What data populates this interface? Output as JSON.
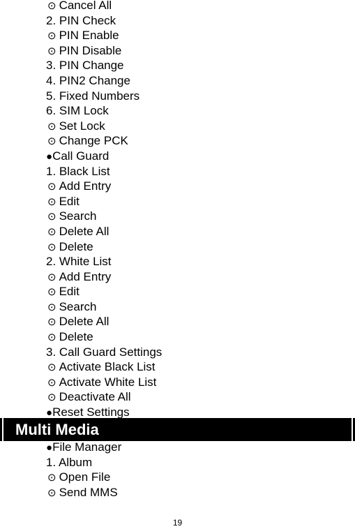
{
  "items_top": [
    {
      "type": "circle",
      "label": "Cancel All"
    },
    {
      "type": "numbered",
      "label": "2. PIN Check"
    },
    {
      "type": "circle",
      "label": "PIN Enable"
    },
    {
      "type": "circle",
      "label": "PIN Disable"
    },
    {
      "type": "numbered",
      "label": "3. PIN Change"
    },
    {
      "type": "numbered",
      "label": "4. PIN2 Change"
    },
    {
      "type": "numbered",
      "label": "5. Fixed Numbers"
    },
    {
      "type": "numbered",
      "label": "6. SIM Lock"
    },
    {
      "type": "circle",
      "label": "Set Lock"
    },
    {
      "type": "circle",
      "label": "Change PCK"
    },
    {
      "type": "bullet",
      "label": "Call Guard"
    },
    {
      "type": "numbered",
      "label": "1. Black List"
    },
    {
      "type": "circle",
      "label": "Add Entry"
    },
    {
      "type": "circle",
      "label": "Edit"
    },
    {
      "type": "circle",
      "label": "Search"
    },
    {
      "type": "circle",
      "label": "Delete All"
    },
    {
      "type": "circle",
      "label": "Delete"
    },
    {
      "type": "numbered",
      "label": "2. White List"
    },
    {
      "type": "circle",
      "label": "Add Entry"
    },
    {
      "type": "circle",
      "label": "Edit"
    },
    {
      "type": "circle",
      "label": "Search"
    },
    {
      "type": "circle",
      "label": "Delete All"
    },
    {
      "type": "circle",
      "label": "Delete"
    },
    {
      "type": "numbered",
      "label": "3. Call Guard Settings"
    },
    {
      "type": "circle",
      "label": "Activate Black List"
    },
    {
      "type": "circle",
      "label": "Activate White List"
    },
    {
      "type": "circle",
      "label": "Deactivate All"
    },
    {
      "type": "bullet",
      "label": "Reset Settings"
    }
  ],
  "section": {
    "title": "Multi Media"
  },
  "items_bottom": [
    {
      "type": "bullet",
      "label": "File Manager"
    },
    {
      "type": "numbered",
      "label": "1. Album"
    },
    {
      "type": "circle",
      "label": "Open File"
    },
    {
      "type": "circle",
      "label": "Send MMS"
    }
  ],
  "symbols": {
    "circle": "⊙",
    "bullet": "●"
  },
  "page_number": "19"
}
